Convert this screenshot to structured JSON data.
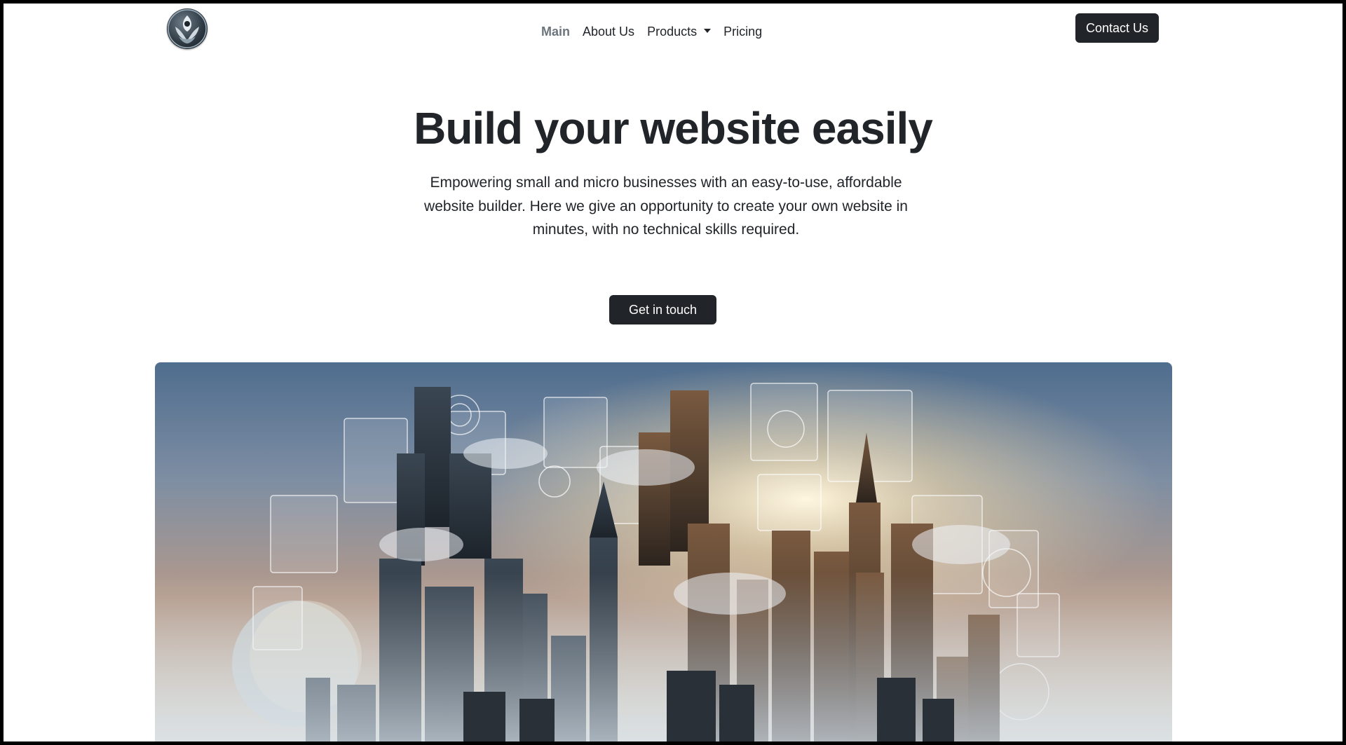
{
  "nav": {
    "items": [
      {
        "label": "Main",
        "active": true
      },
      {
        "label": "About Us",
        "active": false
      },
      {
        "label": "Products",
        "active": false,
        "dropdown": true
      },
      {
        "label": "Pricing",
        "active": false
      }
    ],
    "contact_label": "Contact Us"
  },
  "hero": {
    "title": "Build your website easily",
    "subtitle": "Empowering small and micro businesses with an easy-to-use, affordable website builder. Here we give an opportunity to create your own website in minutes, with no technical skills required.",
    "cta_label": "Get in touch"
  },
  "colors": {
    "primary_dark": "#212529",
    "nav_active": "#6c757d",
    "background": "#ffffff"
  },
  "icons": {
    "logo": "leaf-emblem-logo",
    "dropdown": "caret-down-icon"
  }
}
